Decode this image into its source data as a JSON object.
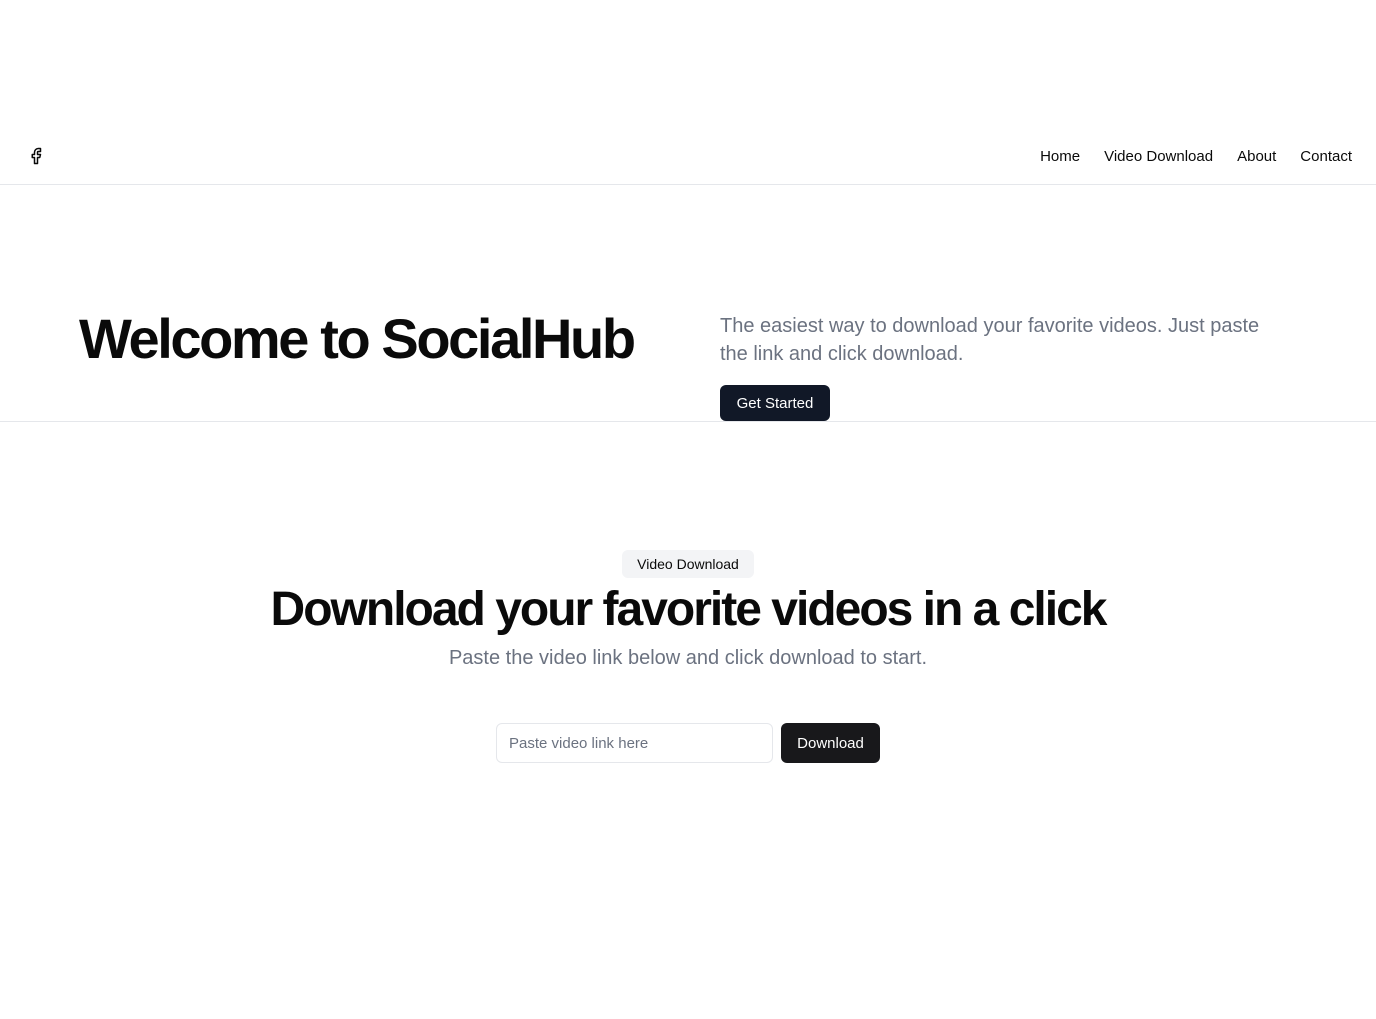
{
  "header": {
    "logo_icon": "facebook-icon",
    "nav": [
      {
        "label": "Home"
      },
      {
        "label": "Video Download"
      },
      {
        "label": "About"
      },
      {
        "label": "Contact"
      }
    ]
  },
  "hero": {
    "title": "Welcome to SocialHub",
    "description": "The easiest way to download your favorite videos. Just paste the link and click download.",
    "cta_label": "Get Started"
  },
  "download": {
    "badge": "Video Download",
    "title": "Download your favorite videos in a click",
    "subtitle": "Paste the video link below and click download to start.",
    "input_placeholder": "Paste video link here",
    "input_value": "",
    "button_label": "Download"
  },
  "colors": {
    "text": "#0a0a0a",
    "muted": "#6b7280",
    "primary_button": "#111827",
    "download_button": "#18181b",
    "border": "#e5e7eb",
    "badge_bg": "#f3f4f6"
  }
}
